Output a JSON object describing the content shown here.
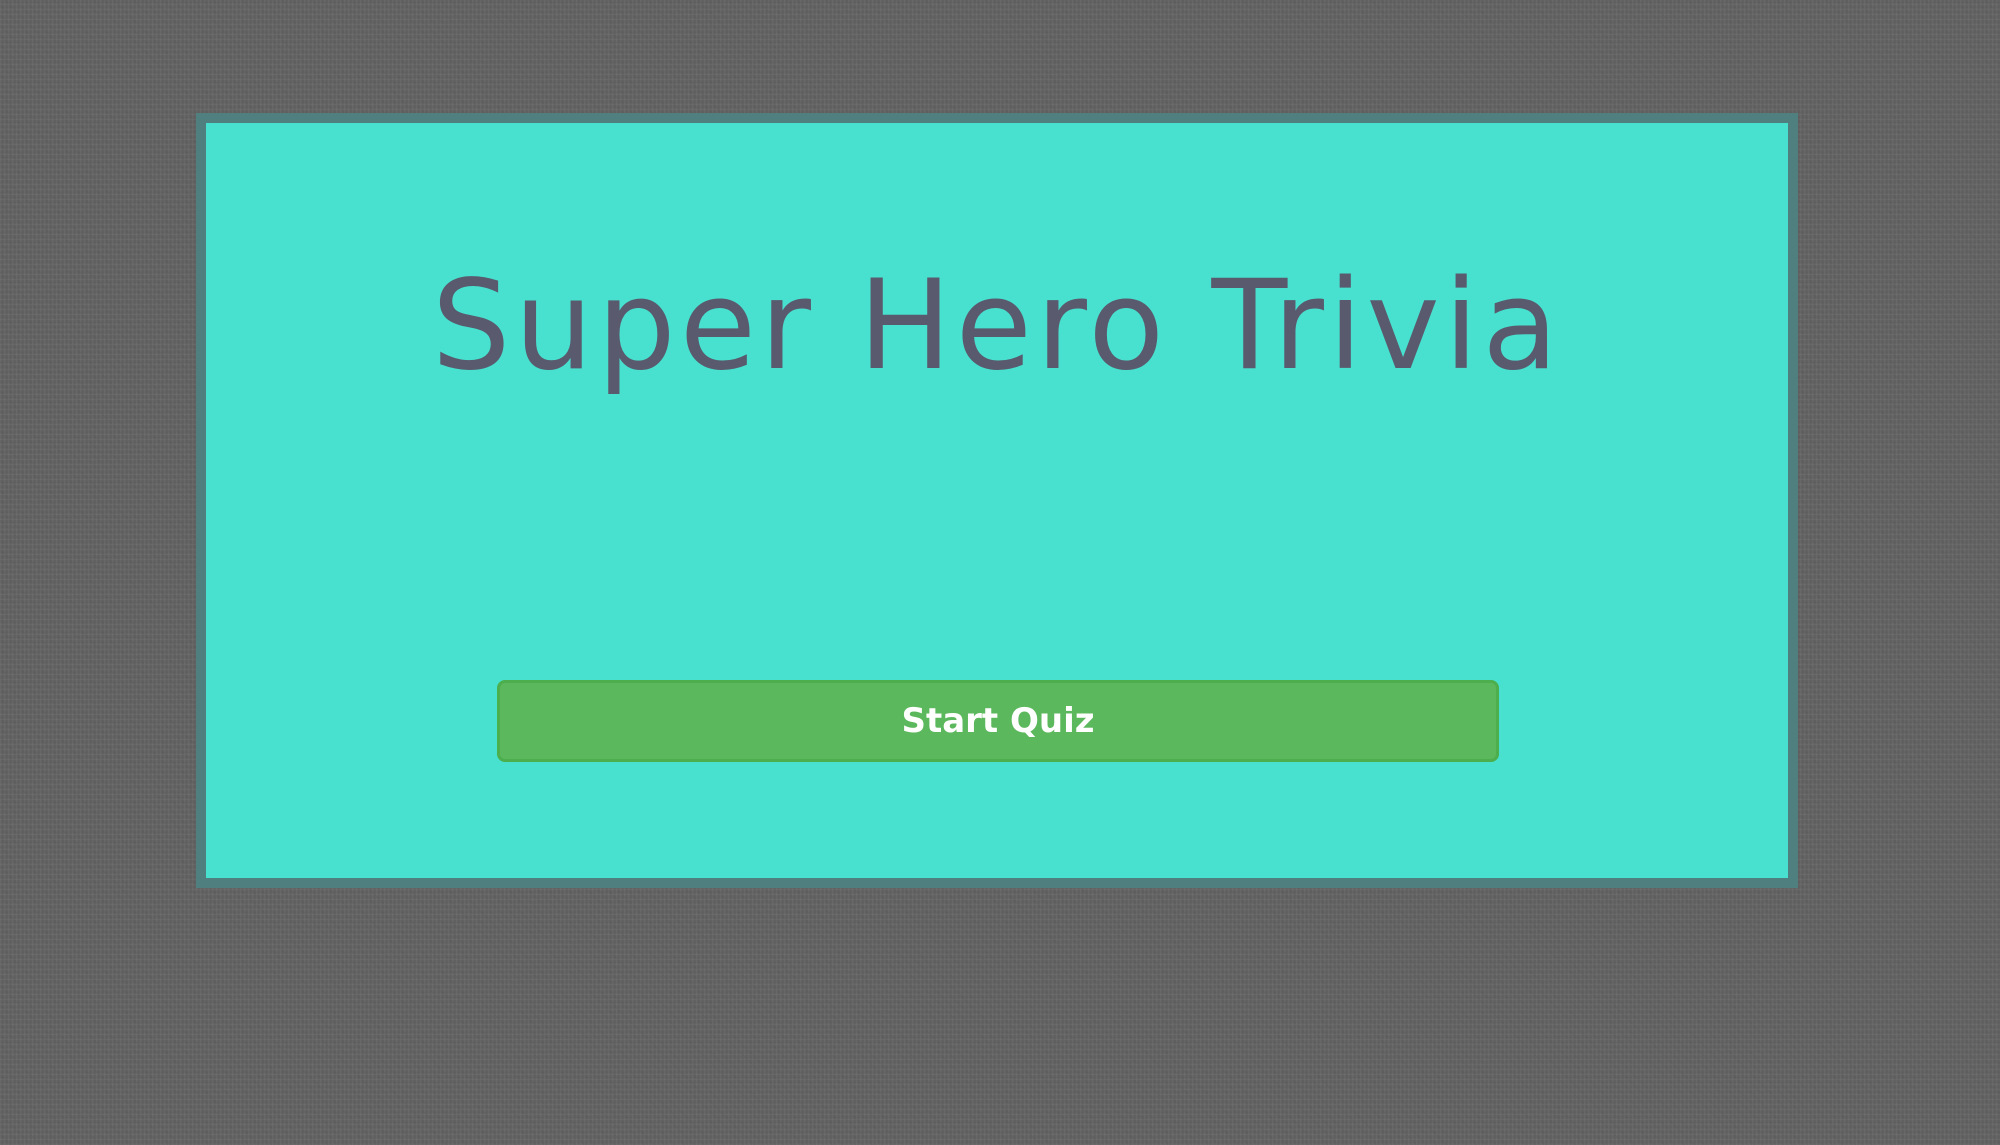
{
  "quiz": {
    "title": "Super Hero Trivia",
    "start_label": "Start Quiz"
  },
  "colors": {
    "page_background": "#636363",
    "card_background": "#48e1cf",
    "card_border": "#4f7f7f",
    "title_text": "#5a5a6e",
    "button_background": "#5cb85c",
    "button_text": "#ffffff"
  }
}
